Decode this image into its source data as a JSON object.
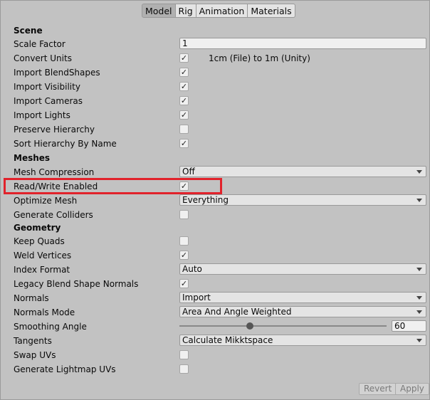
{
  "tabs": [
    "Model",
    "Rig",
    "Animation",
    "Materials"
  ],
  "sections": {
    "scene": "Scene",
    "meshes": "Meshes",
    "geometry": "Geometry"
  },
  "fields": {
    "scale_factor": {
      "label": "Scale Factor",
      "value": "1"
    },
    "convert_units": {
      "label": "Convert Units",
      "checked": "✓",
      "hint": "1cm (File) to 1m (Unity)"
    },
    "import_blendshapes": {
      "label": "Import BlendShapes",
      "checked": "✓"
    },
    "import_visibility": {
      "label": "Import Visibility",
      "checked": "✓"
    },
    "import_cameras": {
      "label": "Import Cameras",
      "checked": "✓"
    },
    "import_lights": {
      "label": "Import Lights",
      "checked": "✓"
    },
    "preserve_hierarchy": {
      "label": "Preserve Hierarchy",
      "checked": ""
    },
    "sort_hierarchy": {
      "label": "Sort Hierarchy By Name",
      "checked": "✓"
    },
    "mesh_compression": {
      "label": "Mesh Compression",
      "value": "Off"
    },
    "read_write": {
      "label": "Read/Write Enabled",
      "checked": "✓"
    },
    "optimize_mesh": {
      "label": "Optimize Mesh",
      "value": "Everything"
    },
    "generate_colliders": {
      "label": "Generate Colliders",
      "checked": ""
    },
    "keep_quads": {
      "label": "Keep Quads",
      "checked": ""
    },
    "weld_vertices": {
      "label": "Weld Vertices",
      "checked": "✓"
    },
    "index_format": {
      "label": "Index Format",
      "value": "Auto"
    },
    "legacy_blend": {
      "label": "Legacy Blend Shape Normals",
      "checked": "✓"
    },
    "normals": {
      "label": "Normals",
      "value": "Import"
    },
    "normals_mode": {
      "label": "Normals Mode",
      "value": "Area And Angle Weighted"
    },
    "smoothing_angle": {
      "label": "Smoothing Angle",
      "value": "60",
      "slider_fraction": 0.333
    },
    "tangents": {
      "label": "Tangents",
      "value": "Calculate Mikktspace"
    },
    "swap_uvs": {
      "label": "Swap UVs",
      "checked": ""
    },
    "lightmap_uvs": {
      "label": "Generate Lightmap UVs",
      "checked": ""
    }
  },
  "buttons": {
    "revert": "Revert",
    "apply": "Apply"
  },
  "colors": {
    "highlight": "#e1222b",
    "background": "#c2c2c2"
  }
}
